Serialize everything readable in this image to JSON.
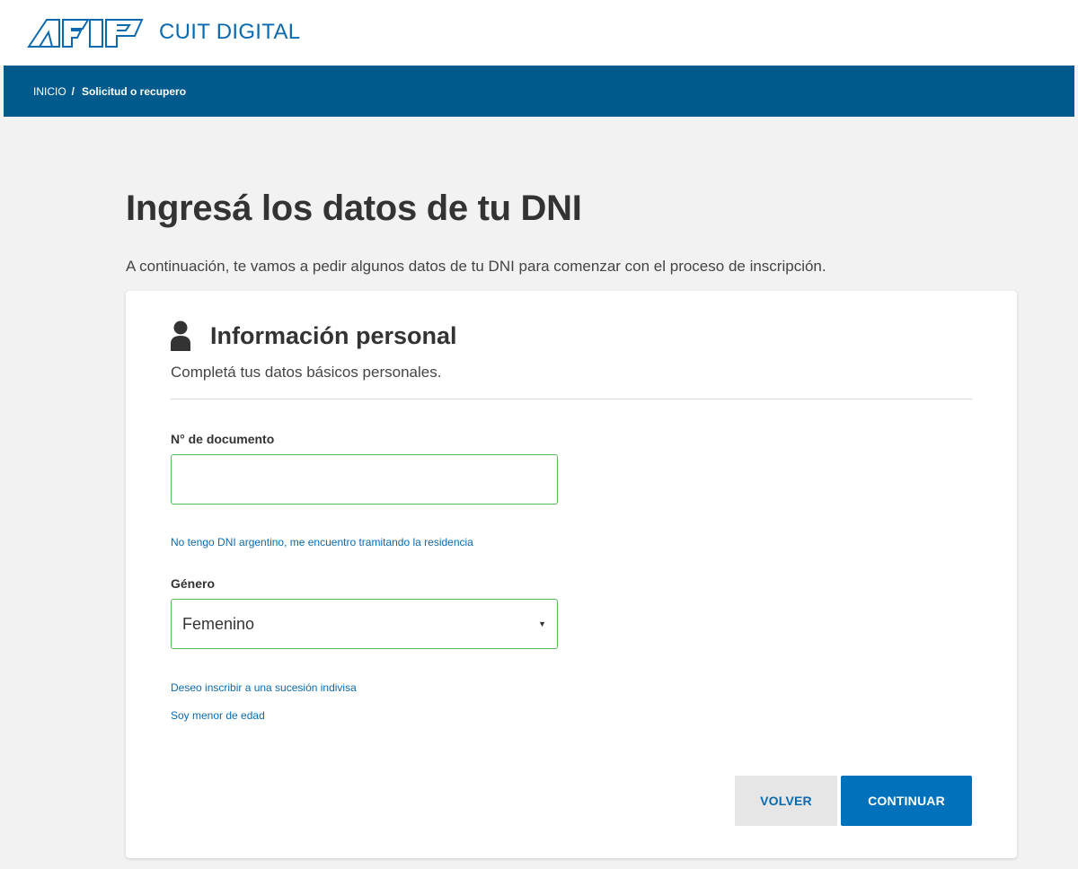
{
  "header": {
    "logo_text": "AFIP",
    "app_title": "CUIT DIGITAL",
    "brand_color": "#0a6ab0",
    "logo_icon": "afip-logo"
  },
  "breadcrumb": {
    "home": "INICIO",
    "separator": "/",
    "current": "Solicitud o recupero",
    "bar_color": "#005a8c"
  },
  "page": {
    "title": "Ingresá los datos de tu DNI",
    "subtitle": "A continuación, te vamos a pedir algunos datos de tu DNI para comenzar con el proceso de inscripción."
  },
  "card": {
    "icon": "user-icon",
    "title": "Información personal",
    "subtitle": "Completá tus datos básicos personales.",
    "document": {
      "label": "N° de documento",
      "value": "",
      "placeholder": ""
    },
    "no_dni_link": "No tengo DNI argentino, me encuentro tramitando la residencia",
    "gender": {
      "label": "Género",
      "selected": "Femenino"
    },
    "sucesion_link": "Deseo inscribir a una sucesión indivisa",
    "minor_link": "Soy menor de edad",
    "back_button": "VOLVER",
    "continue_button": "CONTINUAR",
    "valid_border_color": "#5cb85c",
    "primary_button_color": "#0072bb"
  }
}
